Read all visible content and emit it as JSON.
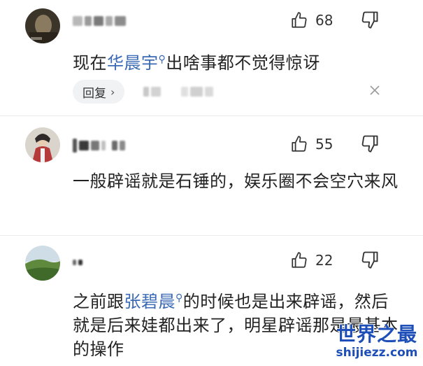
{
  "comments": [
    {
      "like_count": "68",
      "text_before": "现在",
      "mention": "华晨宇",
      "text_after": "出啥事都不觉得惊讶",
      "reply_label": "回复",
      "reply_chevron": "›"
    },
    {
      "like_count": "55",
      "text": "一般辟谣就是石锤的，娱乐圈不会空穴来风"
    },
    {
      "like_count": "22",
      "text_before": "之前跟",
      "mention": "张碧晨",
      "text_after": "的时候也是出来辟谣，然后就是后来娃都出来了，明星辟谣那是最基本的操作"
    }
  ],
  "watermark": {
    "title": "世界之最",
    "subtitle": "shijiezz.com"
  },
  "colors": {
    "mention": "#3a6ab5",
    "watermark": "#1e4fb8",
    "reply_bg": "#f1f2f4"
  },
  "icons": {
    "like": "thumbs-up-icon",
    "dislike": "thumbs-down-icon",
    "search_mark": "search-icon",
    "close": "close-icon"
  }
}
